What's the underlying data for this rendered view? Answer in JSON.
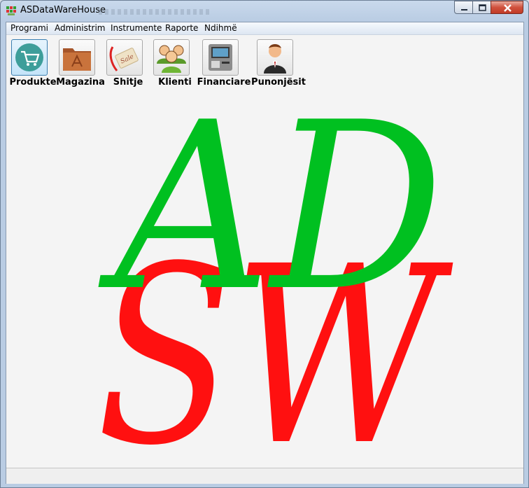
{
  "window": {
    "title": "ASDataWareHouse"
  },
  "menu": [
    {
      "label": "Programi"
    },
    {
      "label": "Administrim"
    },
    {
      "label": "Instrumente"
    },
    {
      "label": "Raporte"
    },
    {
      "label": "Ndihmë"
    }
  ],
  "toolbar": [
    {
      "label": "Produkte",
      "icon": "shopping-cart-icon",
      "active": true
    },
    {
      "label": "Magazina",
      "icon": "warehouse-folder-icon"
    },
    {
      "label": "Shitje",
      "icon": "sale-tag-icon"
    },
    {
      "label": "Klienti",
      "icon": "clients-group-icon"
    },
    {
      "label": "Financiare",
      "icon": "atm-machine-icon"
    },
    {
      "label": "Punonjësit",
      "icon": "employee-icon"
    }
  ],
  "logo": {
    "top_letters": "AD",
    "bottom_letters": "SW",
    "colors": {
      "green": "#00c020",
      "red": "#ff1010"
    }
  },
  "colors": {
    "accent": "#3c7fb1",
    "close": "#c13b26"
  }
}
